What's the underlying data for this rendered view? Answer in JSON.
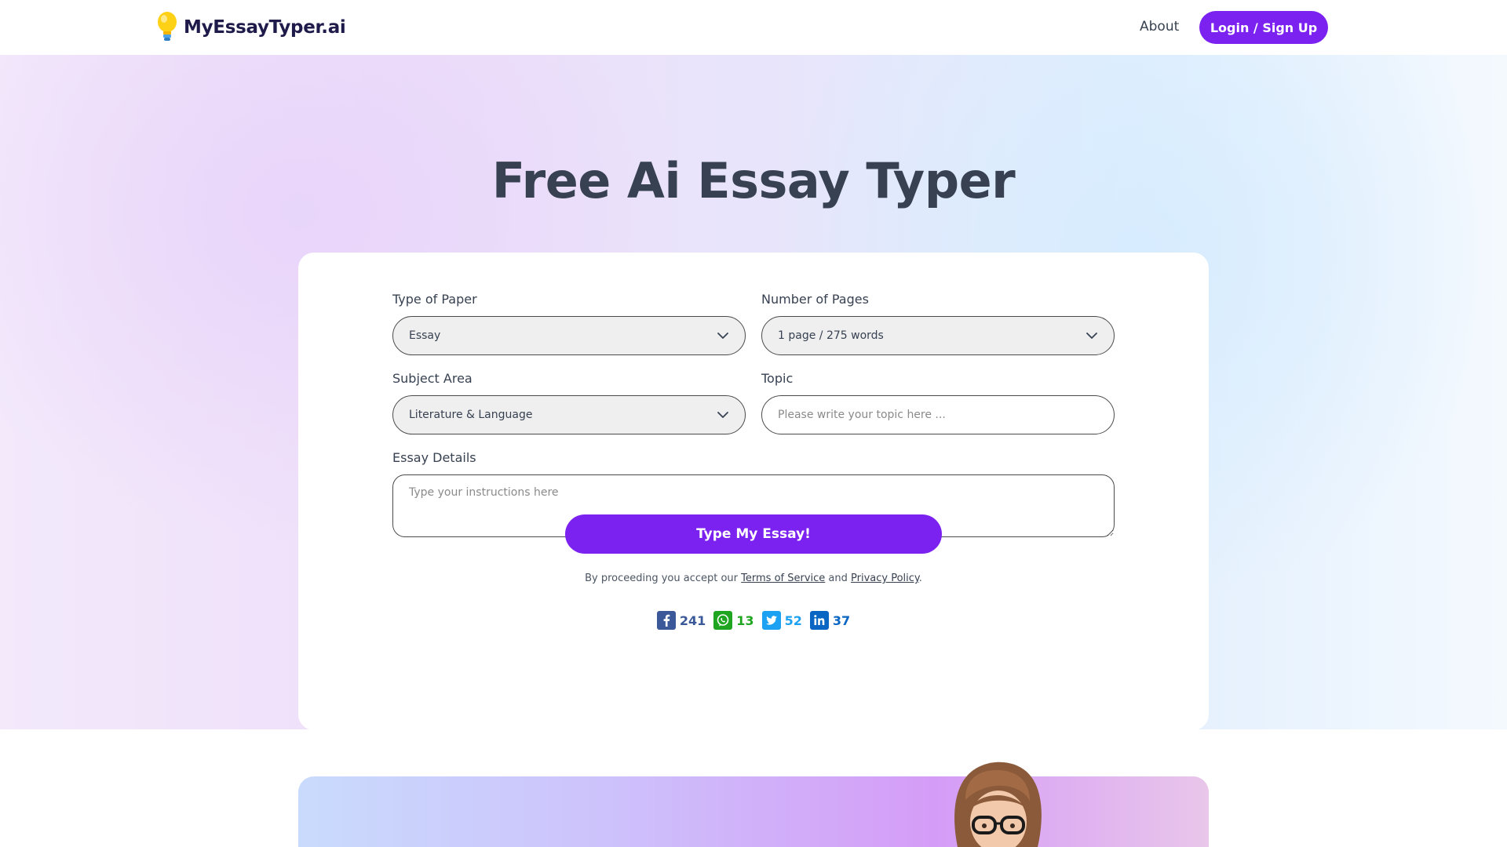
{
  "nav": {
    "logo_text": "MyEssayTyper.ai",
    "about_label": "About",
    "login_label": "Login / Sign Up"
  },
  "hero": {
    "title": "Free Ai Essay Typer"
  },
  "form": {
    "paper_type": {
      "label": "Type of Paper",
      "value": "Essay"
    },
    "pages": {
      "label": "Number of Pages",
      "value": "1 page / 275 words"
    },
    "subject": {
      "label": "Subject Area",
      "value": "Literature & Language"
    },
    "topic": {
      "label": "Topic",
      "value": "",
      "placeholder": "Please write your topic here ..."
    },
    "details": {
      "label": "Essay Details",
      "value": "",
      "placeholder": "Type your instructions here"
    },
    "submit_label": "Type My Essay!",
    "consent": {
      "prefix": "By proceeding you accept our ",
      "terms_label": "Terms of Service",
      "middle": " and ",
      "privacy_label": "Privacy Policy",
      "suffix": "."
    }
  },
  "shares": [
    {
      "network": "facebook",
      "icon": "facebook-icon",
      "count": "241",
      "color": "#3b5998"
    },
    {
      "network": "whatsapp",
      "icon": "whatsapp-icon",
      "count": "13",
      "color": "#1fa51f"
    },
    {
      "network": "twitter",
      "icon": "twitter-icon",
      "count": "52",
      "color": "#1da1f2"
    },
    {
      "network": "linkedin",
      "icon": "linkedin-icon",
      "count": "37",
      "color": "#0a66c2"
    }
  ],
  "colors": {
    "accent": "#7c22f0",
    "heading": "#374151",
    "logo_text": "#1e1b4b"
  }
}
